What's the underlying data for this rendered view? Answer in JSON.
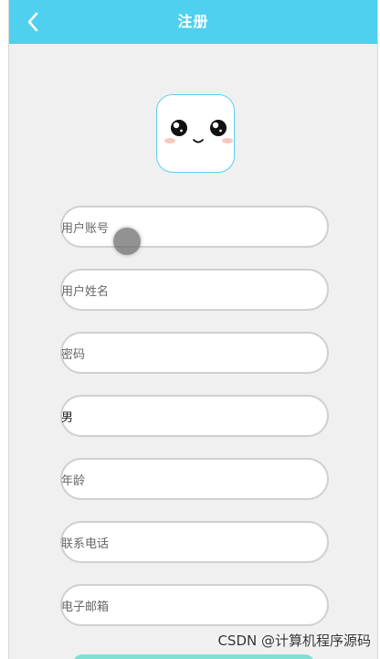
{
  "header": {
    "title": "注册"
  },
  "form": {
    "fields": [
      {
        "name": "account",
        "text": "用户账号"
      },
      {
        "name": "username",
        "text": "用户姓名"
      },
      {
        "name": "password",
        "text": "密码"
      },
      {
        "name": "gender",
        "text": "男"
      },
      {
        "name": "age",
        "text": "年龄"
      },
      {
        "name": "phone",
        "text": "联系电话"
      },
      {
        "name": "email",
        "text": "电子邮箱"
      }
    ]
  },
  "watermark": {
    "text": "CSDN @计算机程序源码"
  },
  "colors": {
    "header": "#4fd0ee",
    "avatar_border": "#5ccff0",
    "background": "#f0f0f0"
  },
  "icons": {
    "back": "chevron-left-icon",
    "avatar": "cute-face-avatar"
  }
}
